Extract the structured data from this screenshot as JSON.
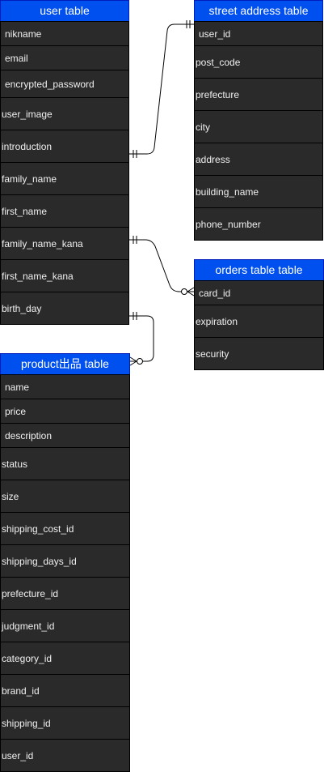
{
  "user_table": {
    "title": "user table",
    "fields": [
      "nikname",
      "email",
      "encrypted_password",
      "user_image",
      "introduction",
      "family_name",
      "first_name",
      "family_name_kana",
      "first_name_kana",
      "birth_day"
    ]
  },
  "street_address_table": {
    "title": "street address table",
    "fields": [
      "user_id",
      "post_code",
      "prefecture",
      "city",
      "address",
      "building_name",
      "phone_number"
    ]
  },
  "orders_table": {
    "title": "orders table table",
    "fields": [
      "card_id",
      "expiration",
      "security"
    ]
  },
  "product_table": {
    "title": "product出品 table",
    "fields": [
      "name",
      "price",
      "description",
      "status",
      "size",
      "shipping_cost_id",
      "shipping_days_id",
      "prefecture_id",
      "judgment_id",
      "category_id",
      "brand_id",
      "shipping_id",
      "user_id"
    ]
  },
  "colors": {
    "header_fill": "#0050ef",
    "row_fill": "#2a2a2a",
    "header_border": "#001dbc"
  }
}
